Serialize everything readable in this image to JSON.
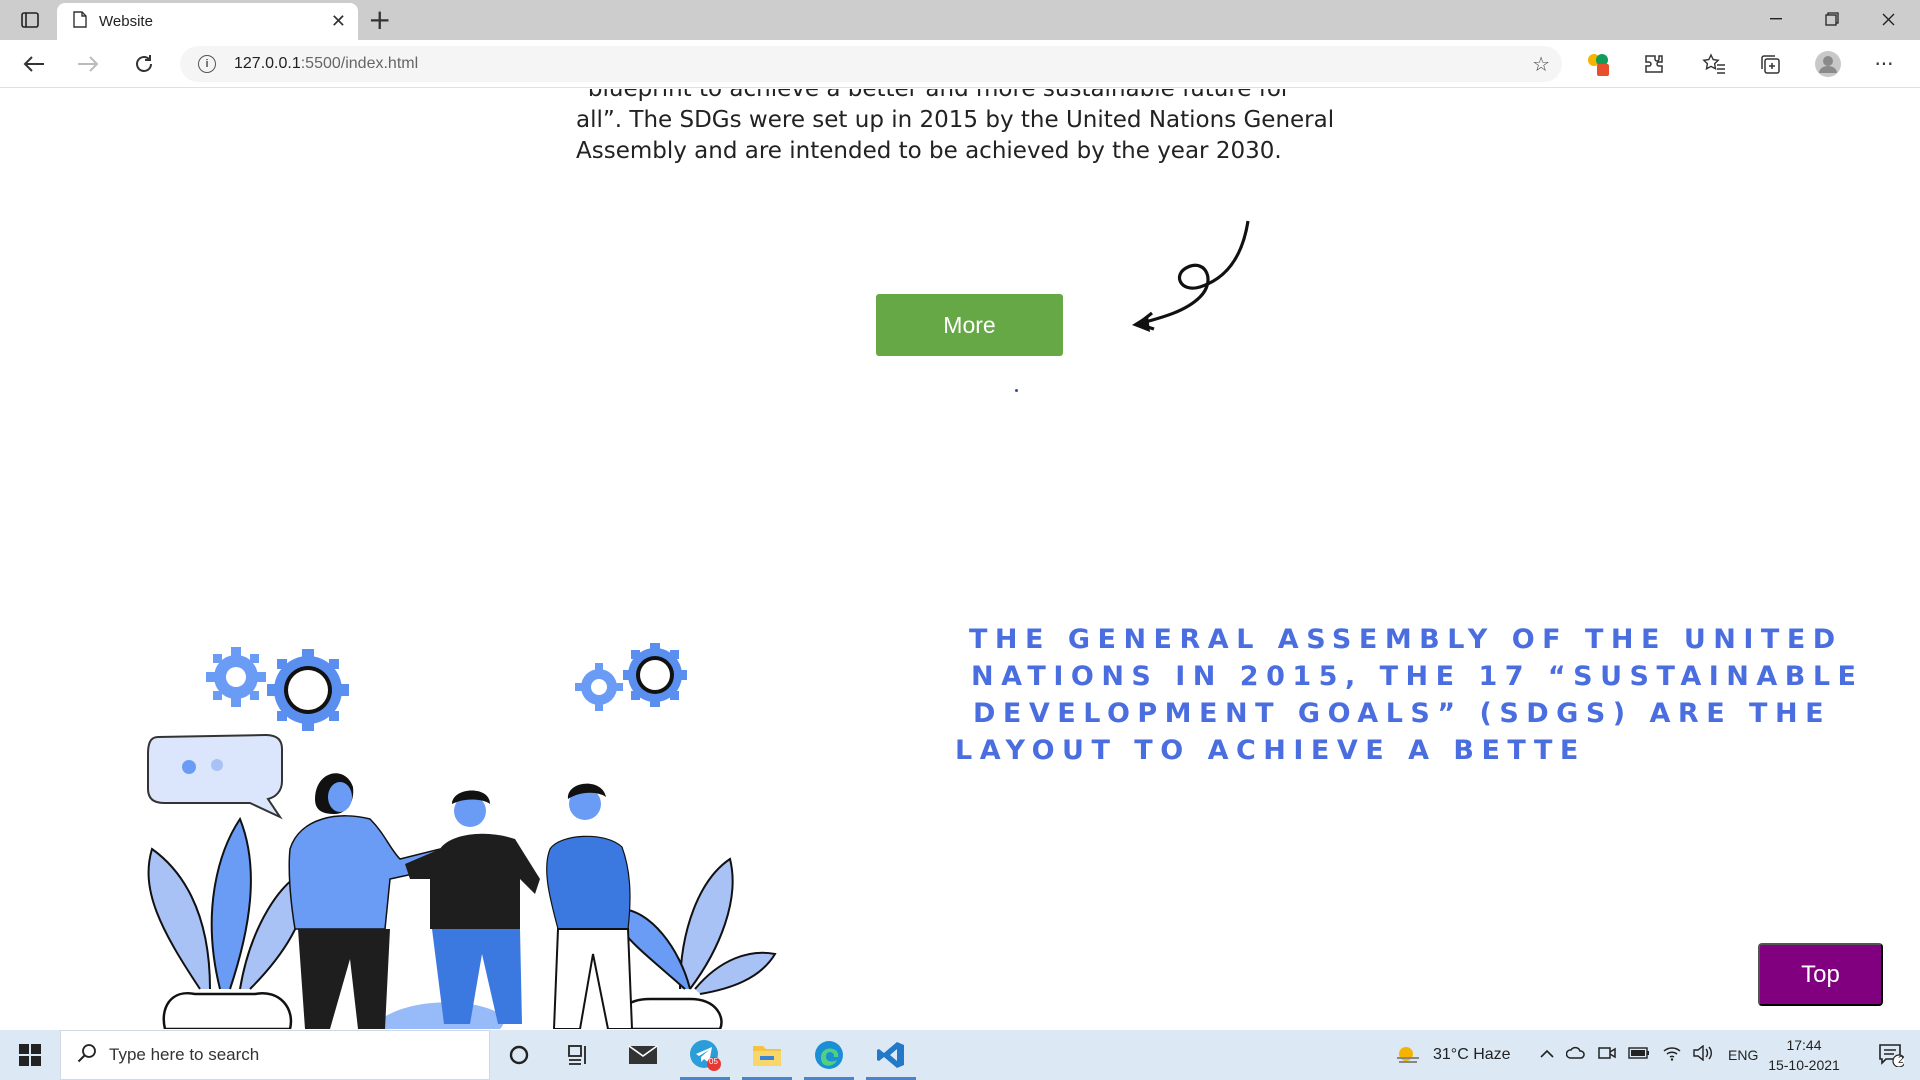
{
  "browser": {
    "tab_title": "Website",
    "url_host": "127.0.0.1",
    "url_rest": ":5500/index.html",
    "new_tab": "+"
  },
  "page": {
    "paragraph_lines": [
      "“blueprint to achieve a better and more sustainable future for",
      "all”. The SDGs were set up in 2015 by the United Nations General",
      "Assembly and are intended to be achieved by the year 2030."
    ],
    "more_button": "More",
    "headline_lines": [
      "THE GENERAL ASSEMBLY OF THE UNITED",
      "NATIONS IN 2015, THE 17 “SUSTAINABLE",
      "DEVELOPMENT GOALS” (SDGS) ARE THE",
      "LAYOUT TO ACHIEVE A BETTE"
    ],
    "top_button": "Top",
    "colors": {
      "more_button": "#65a845",
      "top_button": "#800080",
      "headline": "#4a6de0",
      "illustration_blue": "#6b9cf5"
    }
  },
  "taskbar": {
    "search_placeholder": "Type here to search",
    "weather": "31°C  Haze",
    "language": "ENG",
    "time": "17:44",
    "date": "15-10-2021",
    "notification_count": "2",
    "telegram_badge": "05",
    "apps": [
      "task-view",
      "file-explorer",
      "mail",
      "telegram",
      "folder",
      "edge",
      "vscode"
    ]
  }
}
